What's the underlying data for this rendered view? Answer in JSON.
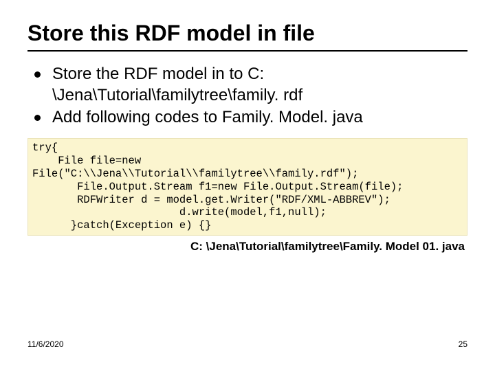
{
  "title": "Store this RDF model in file",
  "bullets": [
    "Store the RDF model in to C: \\Jena\\Tutorial\\familytree\\family. rdf",
    "Add following codes to Family. Model. java"
  ],
  "code": "try{\n    File file=new\nFile(\"C:\\\\Jena\\\\Tutorial\\\\familytree\\\\family.rdf\");\n       File.Output.Stream f1=new File.Output.Stream(file);\n       RDFWriter d = model.get.Writer(\"RDF/XML-ABBREV\");\n                       d.write(model,f1,null);\n      }catch(Exception e) {}",
  "caption": "C: \\Jena\\Tutorial\\familytree\\Family. Model 01. java",
  "footer": {
    "date": "11/6/2020",
    "page": "25"
  }
}
